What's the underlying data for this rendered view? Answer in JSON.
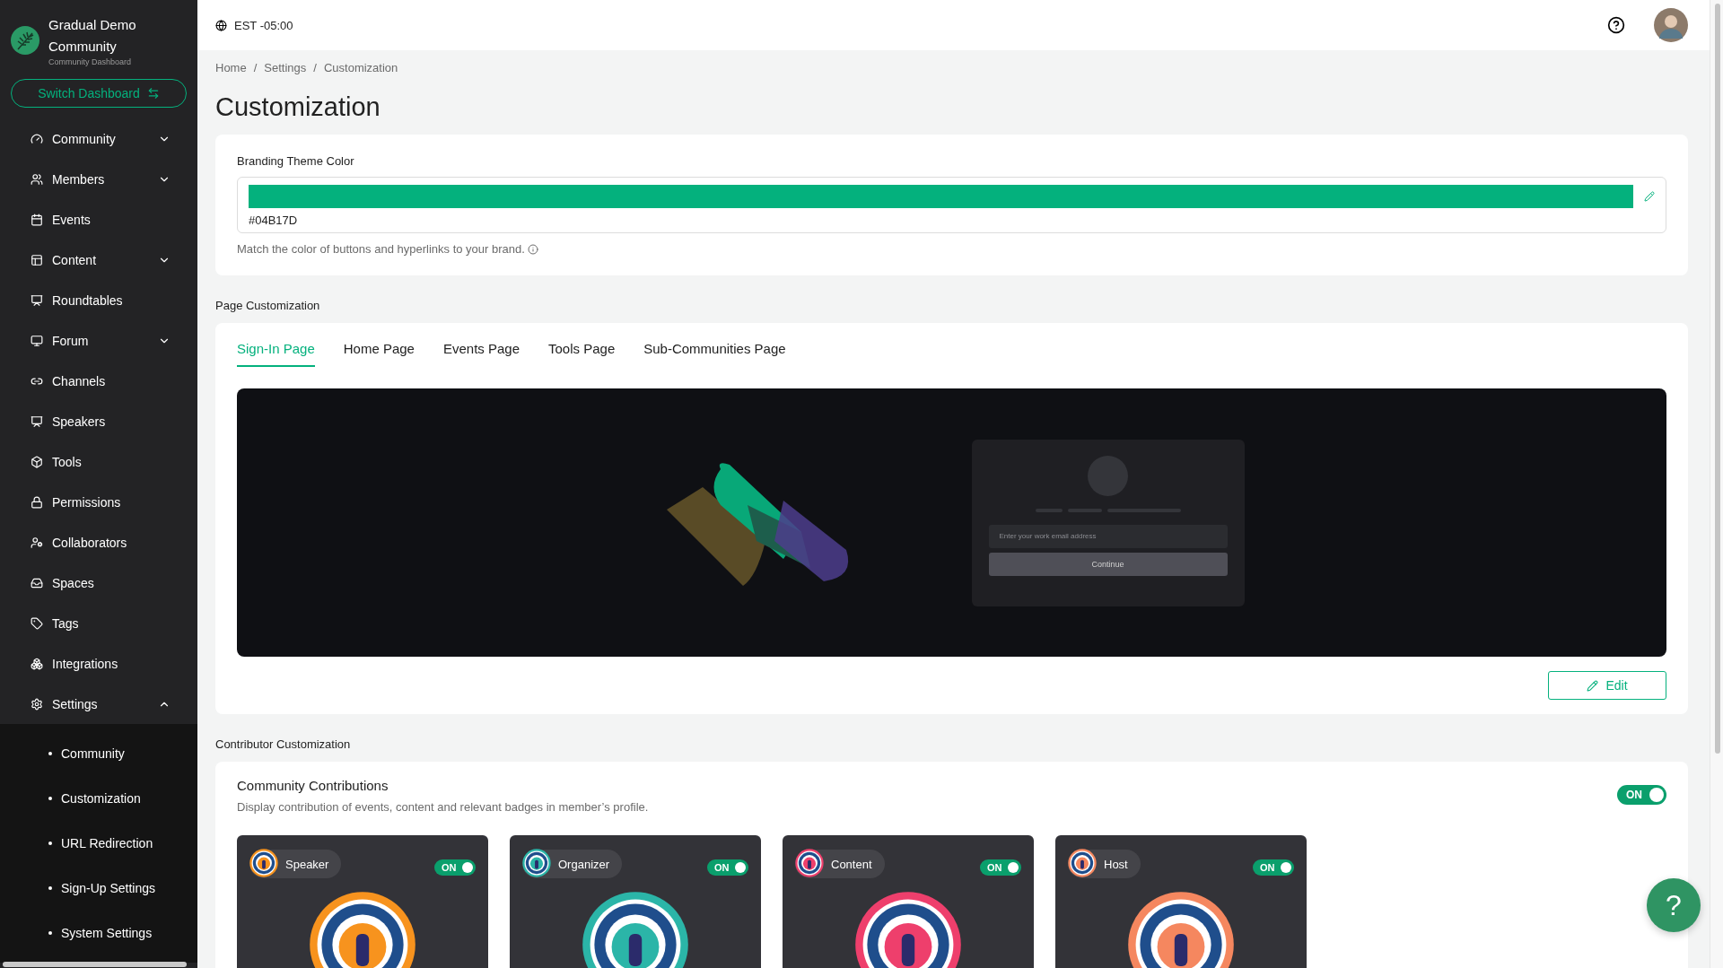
{
  "sidebar": {
    "community_name": "Gradual Demo Community",
    "community_subtitle": "Community Dashboard",
    "switch_button": "Switch Dashboard",
    "items": [
      {
        "label": "Community",
        "expanded": false
      },
      {
        "label": "Members",
        "expanded": false
      },
      {
        "label": "Events"
      },
      {
        "label": "Content",
        "expanded": false
      },
      {
        "label": "Roundtables"
      },
      {
        "label": "Forum",
        "expanded": false
      },
      {
        "label": "Channels"
      },
      {
        "label": "Speakers"
      },
      {
        "label": "Tools"
      },
      {
        "label": "Permissions"
      },
      {
        "label": "Collaborators"
      },
      {
        "label": "Spaces"
      },
      {
        "label": "Tags"
      },
      {
        "label": "Integrations"
      },
      {
        "label": "Settings",
        "expanded": true,
        "children": [
          {
            "label": "Community"
          },
          {
            "label": "Customization"
          },
          {
            "label": "URL Redirection"
          },
          {
            "label": "Sign-Up Settings"
          },
          {
            "label": "System Settings"
          }
        ]
      }
    ]
  },
  "header": {
    "timezone": "EST -05:00"
  },
  "breadcrumb": {
    "separator": "/",
    "items": [
      "Home",
      "Settings",
      "Customization"
    ]
  },
  "page_title": "Customization",
  "branding": {
    "label": "Branding Theme Color",
    "color": "#04b17d",
    "value": "#04B17D",
    "hint": "Match the color of buttons and hyperlinks to your brand."
  },
  "page_customization": {
    "heading": "Page Customization",
    "tabs": [
      {
        "label": "Sign-In Page",
        "selected": true
      },
      {
        "label": "Home Page",
        "selected": false
      },
      {
        "label": "Events Page",
        "selected": false
      },
      {
        "label": "Tools Page",
        "selected": false
      },
      {
        "label": "Sub-Communities Page",
        "selected": false
      }
    ],
    "preview": {
      "email_placeholder": "Enter your work email address",
      "continue_button": "Continue"
    },
    "edit_button": "Edit"
  },
  "contributor_customization": {
    "heading": "Contributor Customization",
    "title": "Community Contributions",
    "description": "Display contribution of events, content and relevant badges in member’s profile.",
    "toggle": {
      "on": true,
      "label": "ON"
    },
    "badges": [
      {
        "name": "Speaker",
        "color": "#f7931e",
        "toggle": {
          "on": true,
          "label": "ON"
        }
      },
      {
        "name": "Organizer",
        "color": "#2bb5a8",
        "toggle": {
          "on": true,
          "label": "ON"
        }
      },
      {
        "name": "Content",
        "color": "#ee3f6c",
        "toggle": {
          "on": true,
          "label": "ON"
        }
      },
      {
        "name": "Host",
        "color": "#f5875f",
        "toggle": {
          "on": true,
          "label": "ON"
        }
      }
    ]
  },
  "help_button": "?"
}
